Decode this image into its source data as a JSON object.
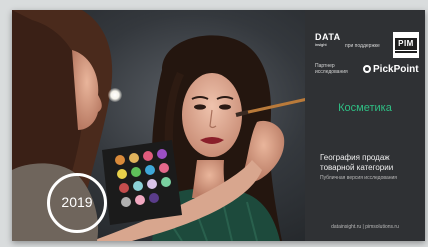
{
  "panel": {
    "datainsight_logo_line1": "DATA",
    "datainsight_logo_line2": "insight",
    "support_text": "при поддержке",
    "pim_logo": "PIM",
    "partner_text": "Партнер исследования",
    "pickpoint_logo": "PickPoint",
    "category": "Косметика",
    "title": "География продаж товарной категории",
    "subtitle": "Публичная версия исследования",
    "links": "datainsight.ru  |  pimsolutions.ru"
  },
  "photo": {
    "year": "2019"
  },
  "colors": {
    "panel_bg": "#2f3134",
    "accent_green": "#2fbf84",
    "text_light": "#f0f0f0"
  }
}
